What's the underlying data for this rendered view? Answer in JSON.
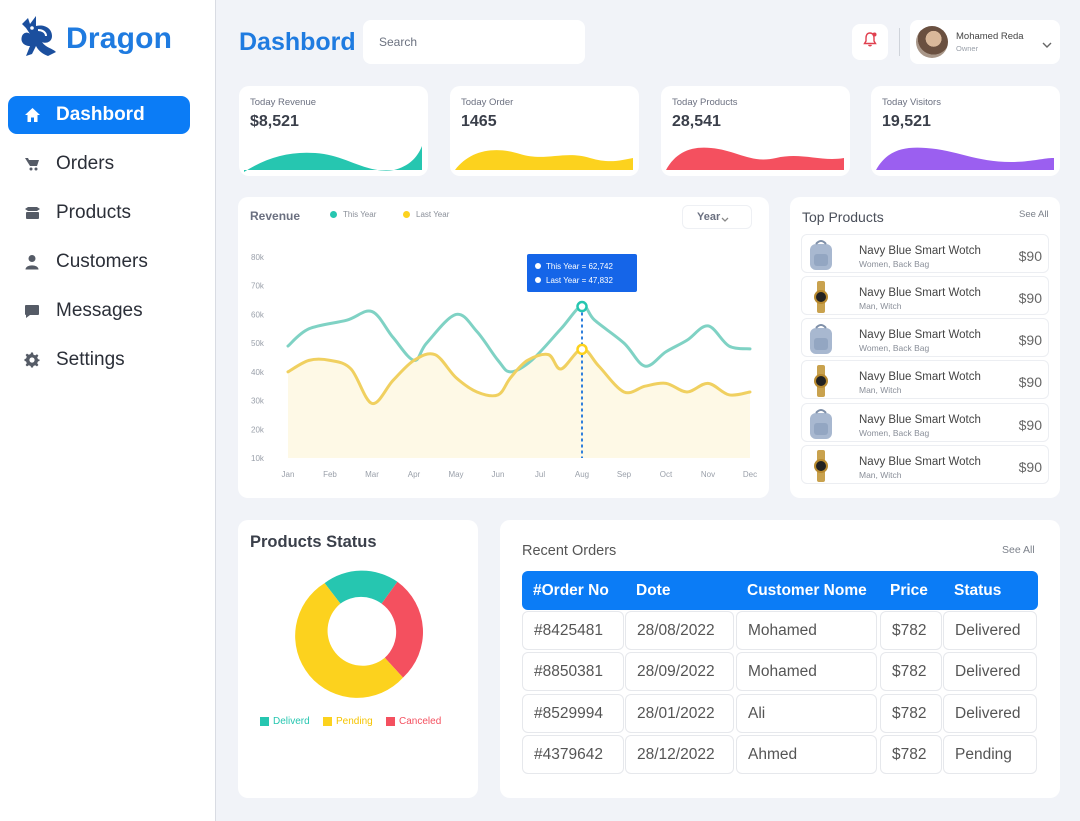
{
  "app": {
    "name": "Dragon"
  },
  "sidebar": {
    "items": [
      {
        "label": "Dashbord",
        "icon": "home-icon",
        "active": true
      },
      {
        "label": "Orders",
        "icon": "orders-icon"
      },
      {
        "label": "Products",
        "icon": "box-icon"
      },
      {
        "label": "Customers",
        "icon": "user-icon"
      },
      {
        "label": "Messages",
        "icon": "message-icon"
      },
      {
        "label": "Settings",
        "icon": "gear-icon"
      }
    ]
  },
  "header": {
    "title": "Dashbord",
    "search_placeholder": "Search",
    "user": {
      "name": "Mohamed Reda",
      "role": "Owner"
    }
  },
  "stats": [
    {
      "label": "Today Revenue",
      "value": "$8,521",
      "color": "#26c6b0"
    },
    {
      "label": "Today Order",
      "value": "1465",
      "color": "#fcd21e"
    },
    {
      "label": "Today Products",
      "value": "28,541",
      "color": "#f4505f"
    },
    {
      "label": "Today Visitors",
      "value": "19,521",
      "color": "#9b5ff0"
    }
  ],
  "revenue": {
    "title": "Revenue",
    "legend": [
      "This Year",
      "Last Year"
    ],
    "period": "Year",
    "tooltip": [
      "This Year = 62,742",
      "Last Year = 47,832"
    ]
  },
  "chart_data": {
    "type": "line",
    "title": "Revenue",
    "categories": [
      "Jan",
      "Feb",
      "Mar",
      "Apr",
      "May",
      "Jun",
      "Jul",
      "Aug",
      "Sep",
      "Oct",
      "Nov",
      "Dec"
    ],
    "y_ticks": [
      "80k",
      "70k",
      "60k",
      "50k",
      "40k",
      "30k",
      "20k",
      "10k"
    ],
    "ylim": [
      10000,
      80000
    ],
    "series": [
      {
        "name": "This Year",
        "color": "#7fd2c4",
        "x": [
          0,
          0.5,
          1.4,
          2,
          2.5,
          3,
          3.3,
          4,
          4.5,
          5,
          5.3,
          5.8,
          6.5,
          7,
          7.3,
          8,
          8.5,
          9,
          9.5,
          10,
          10.5,
          11
        ],
        "values": [
          49000,
          55000,
          58000,
          61000,
          52000,
          44000,
          50000,
          60000,
          54000,
          44000,
          40000,
          44000,
          55000,
          63000,
          58000,
          50000,
          42000,
          47000,
          51000,
          56000,
          49000,
          48000
        ]
      },
      {
        "name": "Last Year",
        "color": "#f0d060",
        "x": [
          0,
          0.5,
          1,
          1.5,
          2,
          2.5,
          3,
          3.5,
          4,
          4.5,
          5,
          5.3,
          5.7,
          6.2,
          6.5,
          7,
          7.4,
          8,
          8.5,
          9,
          9.5,
          10,
          10.5,
          11
        ],
        "values": [
          40000,
          44000,
          44000,
          41000,
          29000,
          37000,
          44000,
          46000,
          38000,
          33000,
          32000,
          38000,
          44000,
          46000,
          41000,
          48000,
          42000,
          33000,
          35000,
          36000,
          33000,
          36000,
          32000,
          33000
        ]
      }
    ],
    "highlight": {
      "category": "Aug",
      "this_year": 62742,
      "last_year": 47832
    }
  },
  "top_products": {
    "title": "Top Products",
    "see_all": "See All",
    "items": [
      {
        "name": "Navy Blue Smart Wotch",
        "sub": "Women, Back Bag",
        "price": "$90",
        "thumb": "backpack"
      },
      {
        "name": "Navy Blue Smart Wotch",
        "sub": "Man, Witch",
        "price": "$90",
        "thumb": "watch"
      },
      {
        "name": "Navy Blue Smart Wotch",
        "sub": "Women, Back Bag",
        "price": "$90",
        "thumb": "backpack"
      },
      {
        "name": "Navy Blue Smart Wotch",
        "sub": "Man, Witch",
        "price": "$90",
        "thumb": "watch"
      },
      {
        "name": "Navy Blue Smart Wotch",
        "sub": "Women, Back Bag",
        "price": "$90",
        "thumb": "backpack"
      },
      {
        "name": "Navy Blue Smart Wotch",
        "sub": "Man, Witch",
        "price": "$90",
        "thumb": "watch"
      }
    ]
  },
  "products_status": {
    "title": "Products Status",
    "legend": [
      {
        "label": "Deliverd",
        "color": "#26c6b0"
      },
      {
        "label": "Pending",
        "color": "#fcd21e"
      },
      {
        "label": "Canceled",
        "color": "#f4505f"
      }
    ]
  },
  "recent_orders": {
    "title": "Recent Orders",
    "see_all": "See All",
    "columns": [
      "#Order No",
      "Dote",
      "Customer Nome",
      "Price",
      "Status"
    ],
    "rows": [
      [
        "#8425481",
        "28/08/2022",
        "Mohamed",
        "$782",
        "Delivered"
      ],
      [
        "#8850381",
        "28/09/2022",
        "Mohamed",
        "$782",
        "Delivered"
      ],
      [
        "#8529994",
        "28/01/2022",
        "Ali",
        "$782",
        "Delivered"
      ],
      [
        "#4379642",
        "28/12/2022",
        "Ahmed",
        "$782",
        "Pending"
      ]
    ]
  }
}
